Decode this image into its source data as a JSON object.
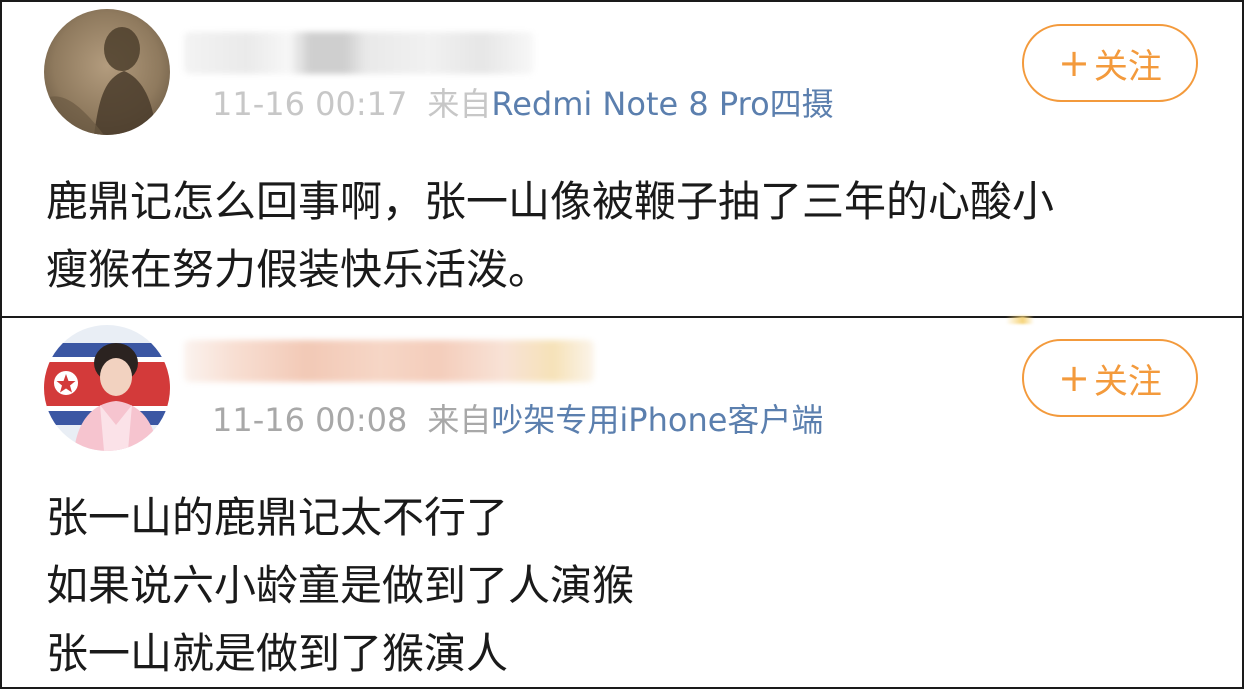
{
  "posts": [
    {
      "time": "11-16 00:17",
      "from_label": "来自",
      "source": "Redmi Note 8 Pro四摄",
      "follow_label": "关注",
      "follow_icon": "plus-icon",
      "content_lines": [
        "鹿鼎记怎么回事啊，张一山像被鞭子抽了三年的心酸小",
        "瘦猴在努力假装快乐活泼。"
      ]
    },
    {
      "time": "11-16 00:08",
      "from_label": "来自",
      "source": "吵架专用iPhone客户端",
      "follow_label": "关注",
      "follow_icon": "plus-icon",
      "content_lines": [
        "张一山的鹿鼎记太不行了",
        "如果说六小龄童是做到了人演猴",
        "张一山就是做到了猴演人"
      ]
    }
  ],
  "colors": {
    "accent": "#f39a3c",
    "link": "#5b7fae",
    "meta": "#a8a8a8",
    "text": "#1a1a1a"
  }
}
